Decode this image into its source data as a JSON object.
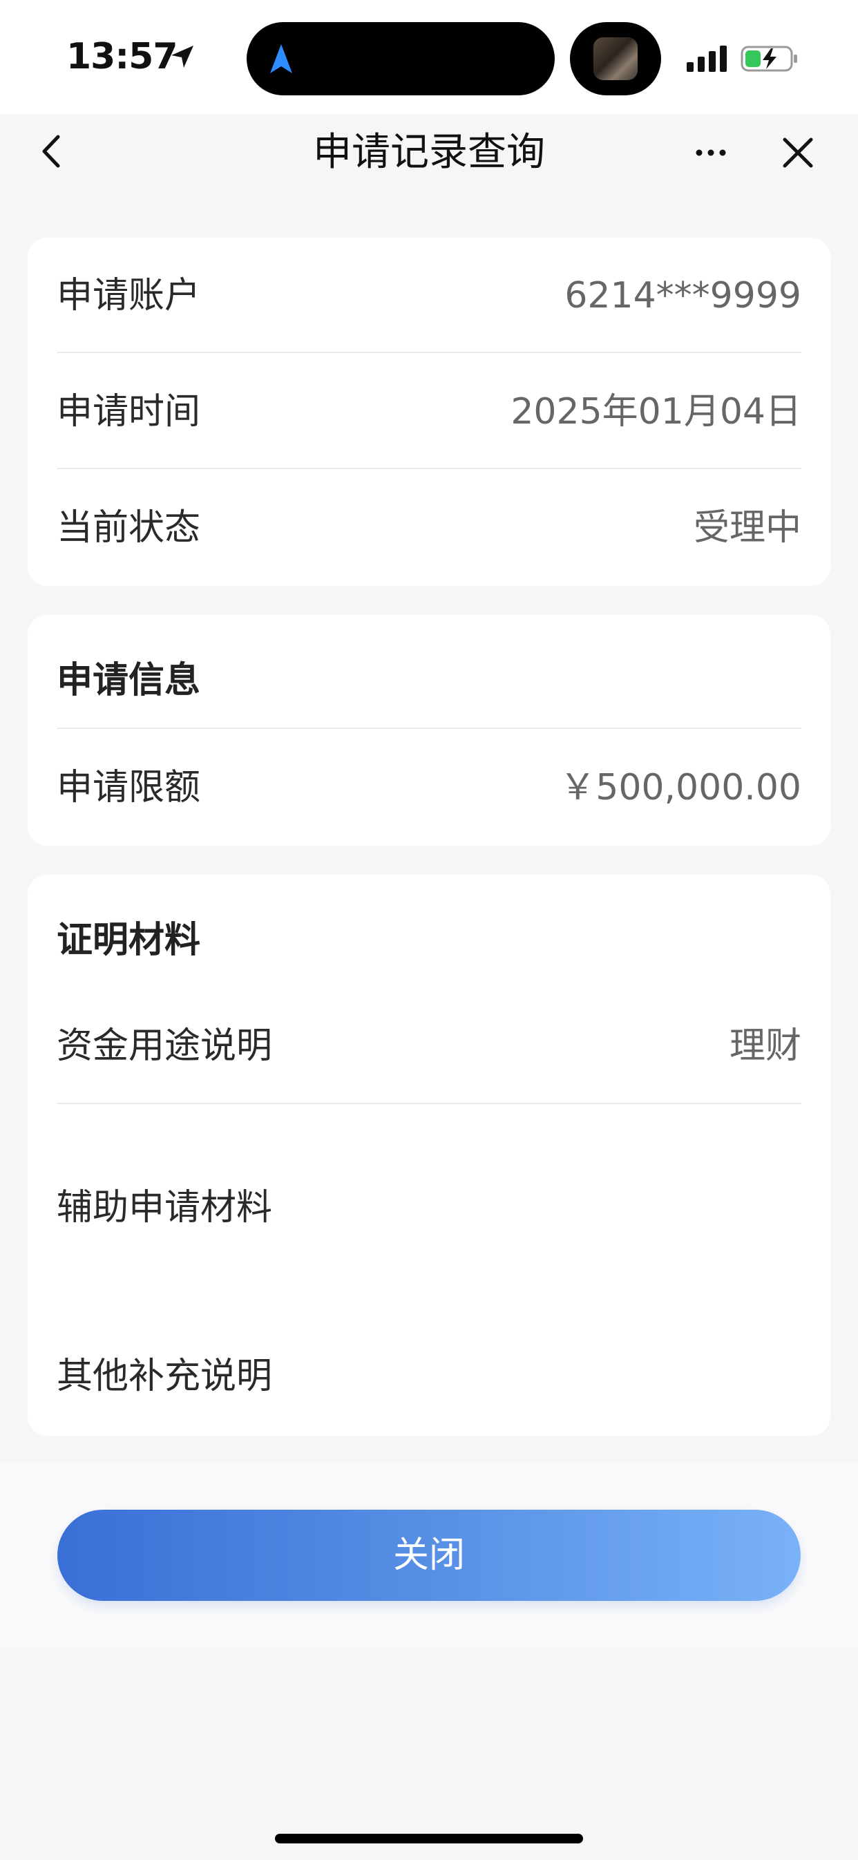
{
  "status_bar": {
    "time": "13:57"
  },
  "nav": {
    "title": "申请记录查询"
  },
  "account_card": {
    "rows": [
      {
        "label": "申请账户",
        "value": "6214***9999"
      },
      {
        "label": "申请时间",
        "value": "2025年01月04日"
      },
      {
        "label": "当前状态",
        "value": "受理中"
      }
    ]
  },
  "apply_info": {
    "title": "申请信息",
    "rows": [
      {
        "label": "申请限额",
        "value": "￥500,000.00"
      }
    ]
  },
  "proof": {
    "title": "证明材料",
    "rows": [
      {
        "label": "资金用途说明",
        "value": "理财"
      },
      {
        "label": "辅助申请材料",
        "value": ""
      },
      {
        "label": "其他补充说明",
        "value": ""
      }
    ]
  },
  "actions": {
    "close_label": "关闭"
  },
  "colors": {
    "accent_start": "#3a6fd6",
    "accent_end": "#79b2f8",
    "background": "#f6f6f7",
    "card": "#ffffff"
  },
  "icons": {
    "location": "location-arrow-icon",
    "island_nav": "navigation-icon",
    "signal": "cellular-signal-icon",
    "battery": "battery-charging-icon",
    "back": "chevron-left-icon",
    "more": "more-horizontal-icon",
    "close": "close-icon"
  }
}
